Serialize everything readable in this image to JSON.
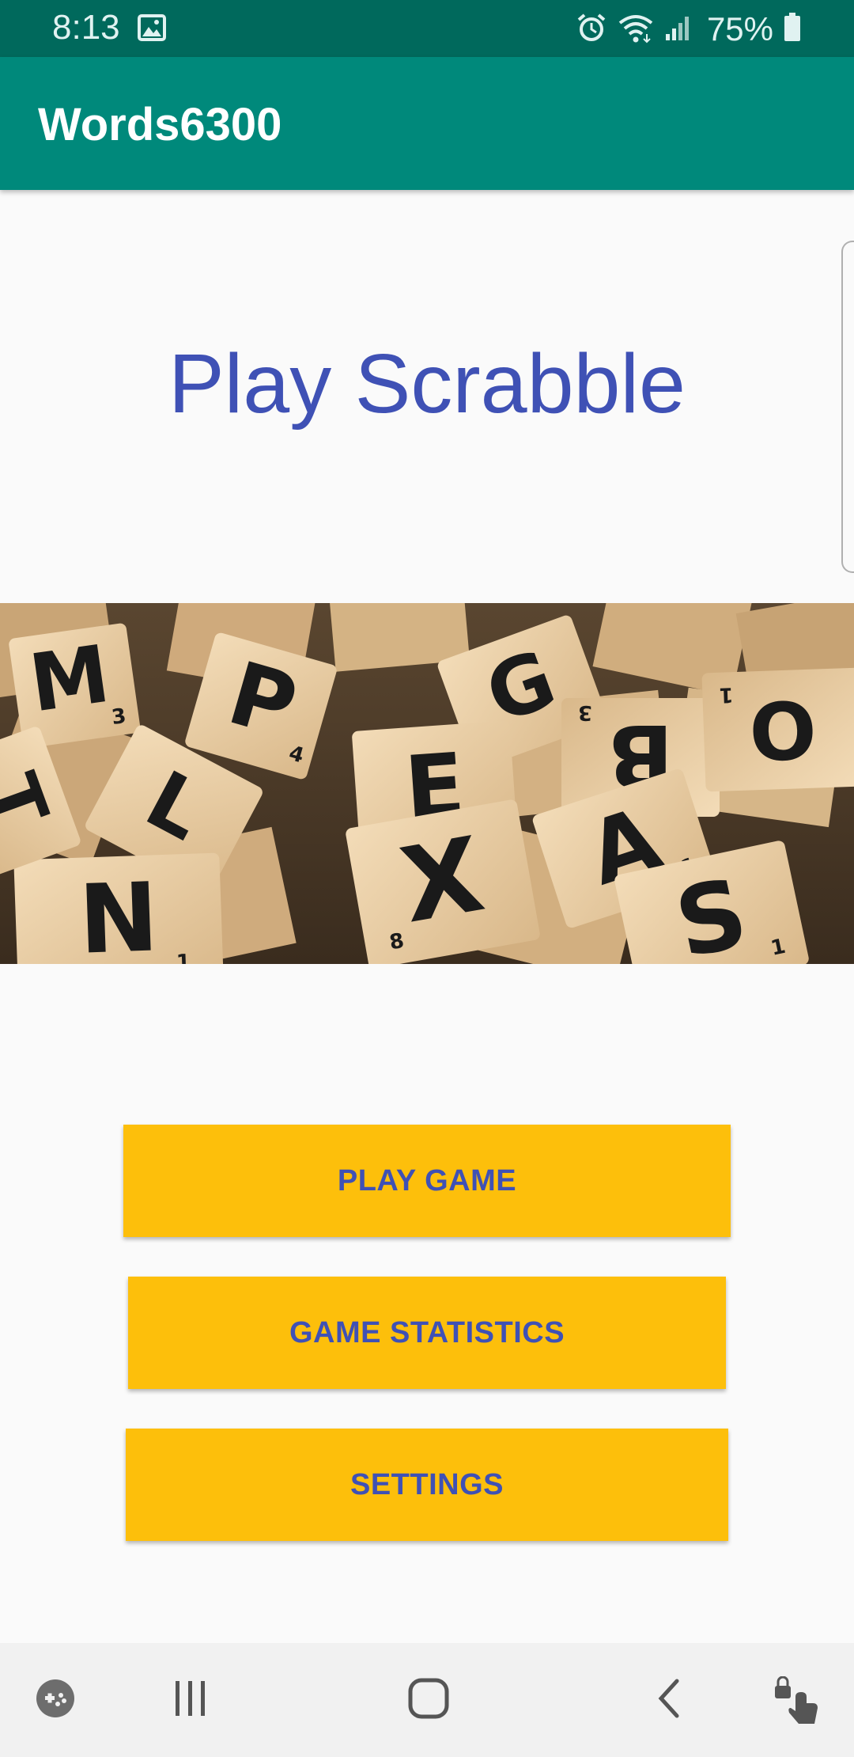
{
  "status_bar": {
    "time": "8:13",
    "battery_percent": "75%",
    "icons": [
      "image-notification-icon",
      "alarm-icon",
      "wifi-icon",
      "cell-signal-icon",
      "battery-icon"
    ]
  },
  "app_bar": {
    "title": "Words6300"
  },
  "main": {
    "headline": "Play Scrabble",
    "hero_image": "scrabble-tiles-photo",
    "tiles_visible": [
      "M",
      "P",
      "E",
      "X",
      "G",
      "B",
      "A",
      "S",
      "O",
      "N"
    ]
  },
  "buttons": {
    "play_game": "PLAY GAME",
    "game_statistics": "GAME STATISTICS",
    "settings": "SETTINGS"
  },
  "nav_bar": {
    "icons": [
      "game-tools-icon",
      "recent-apps-icon",
      "home-icon",
      "back-icon",
      "touch-lock-icon"
    ]
  },
  "colors": {
    "status_bar": "#00695c",
    "app_bar": "#00897b",
    "headline": "#3f51b5",
    "button_bg": "#fdbf0b",
    "button_text": "#3f51b5",
    "background": "#fafafa"
  }
}
